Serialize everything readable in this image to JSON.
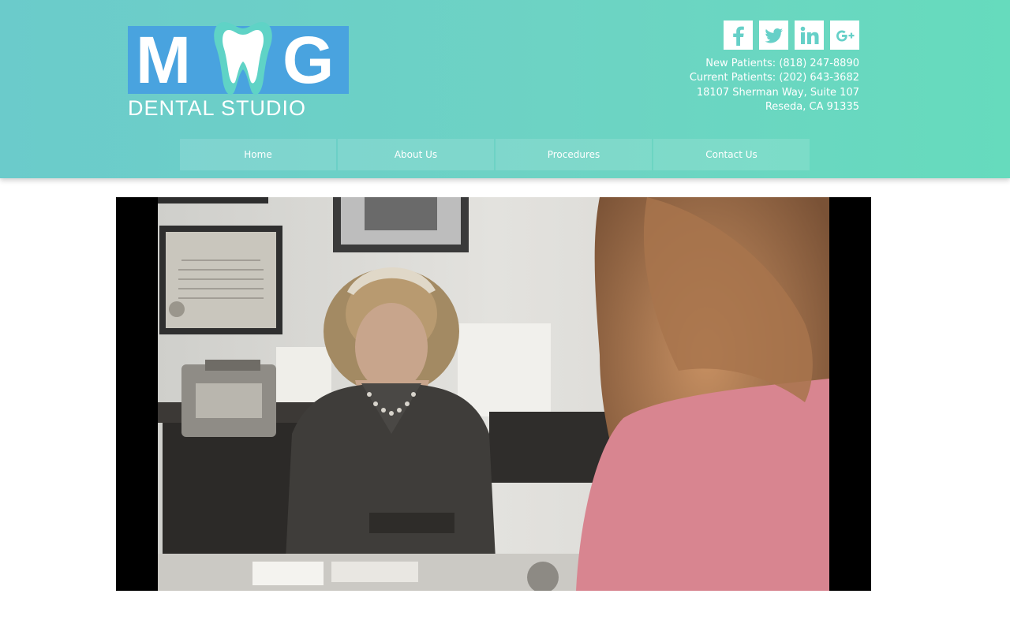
{
  "logo": {
    "letter_left": "M",
    "letter_right": "G",
    "subtitle": "DENTAL STUDIO"
  },
  "social": [
    {
      "name": "facebook-icon",
      "label": "f"
    },
    {
      "name": "twitter-icon",
      "label": ""
    },
    {
      "name": "linkedin-icon",
      "label": "in"
    },
    {
      "name": "google-plus-icon",
      "label": "g+"
    }
  ],
  "contact": {
    "new_patients": "New Patients: (818) 247-8890",
    "current_patients": "Current Patients: (202) 643-3682",
    "address_line1": "18107 Sherman Way, Suite 107",
    "address_line2": "Reseda, CA 91335"
  },
  "nav": [
    {
      "label": "Home"
    },
    {
      "label": "About Us"
    },
    {
      "label": "Procedures"
    },
    {
      "label": "Contact Us"
    }
  ],
  "colors": {
    "header_start": "#6bcbcb",
    "header_end": "#66dbbd",
    "logo_blue": "#49a3df",
    "white": "#ffffff"
  }
}
